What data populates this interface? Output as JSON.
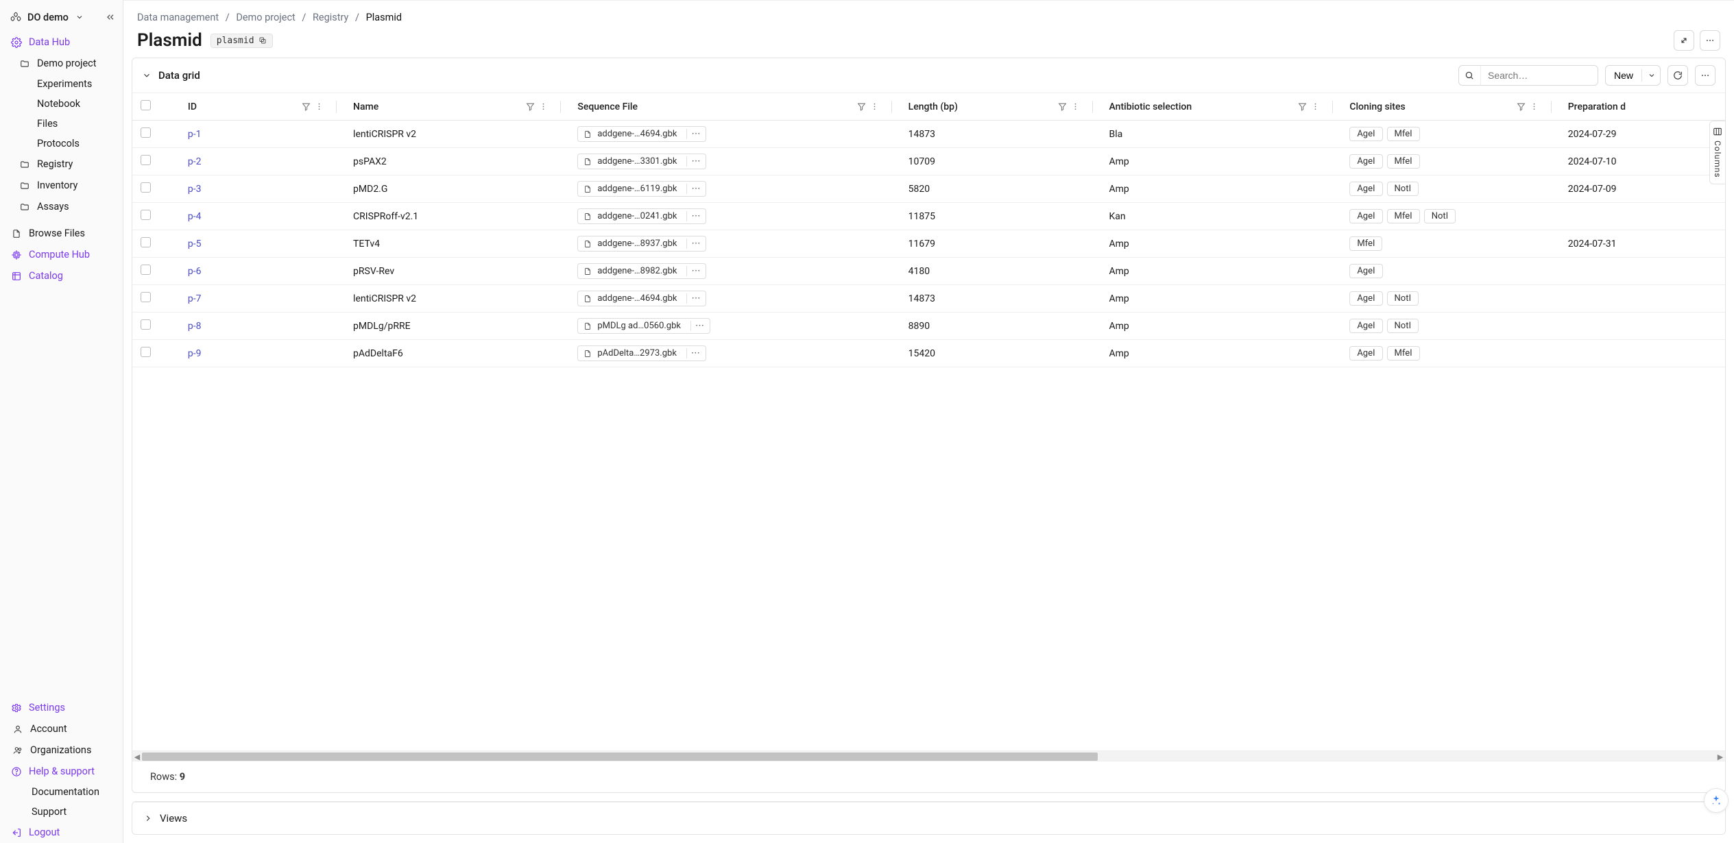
{
  "workspace": {
    "name": "DO demo"
  },
  "sidebar": {
    "data_hub_label": "Data Hub",
    "demo_project_label": "Demo project",
    "children": {
      "experiments": "Experiments",
      "notebook": "Notebook",
      "files": "Files",
      "protocols": "Protocols"
    },
    "registry_label": "Registry",
    "inventory_label": "Inventory",
    "assays_label": "Assays",
    "browse_files_label": "Browse Files",
    "compute_hub_label": "Compute Hub",
    "catalog_label": "Catalog",
    "settings_label": "Settings",
    "account_label": "Account",
    "organizations_label": "Organizations",
    "help_label": "Help & support",
    "documentation_label": "Documentation",
    "support_label": "Support",
    "logout_label": "Logout"
  },
  "breadcrumbs": {
    "a": "Data management",
    "b": "Demo project",
    "c": "Registry",
    "d": "Plasmid"
  },
  "page": {
    "title": "Plasmid",
    "code": "plasmid"
  },
  "grid": {
    "title": "Data grid",
    "search_placeholder": "Search…",
    "new_label": "New",
    "columns_tab_label": "Columns",
    "views_label": "Views",
    "rows_prefix": "Rows: ",
    "rows_count": "9",
    "headers": {
      "id": "ID",
      "name": "Name",
      "seq": "Sequence File",
      "len": "Length (bp)",
      "ant": "Antibiotic selection",
      "sites": "Cloning sites",
      "prep": "Preparation d"
    },
    "rows": [
      {
        "id": "p-1",
        "name": "lentiCRISPR v2",
        "file": "addgene-…4694.gbk",
        "len": "14873",
        "ant": "Bla",
        "sites": [
          "AgeI",
          "MfeI"
        ],
        "prep": "2024-07-29"
      },
      {
        "id": "p-2",
        "name": "psPAX2",
        "file": "addgene-…3301.gbk",
        "len": "10709",
        "ant": "Amp",
        "sites": [
          "AgeI",
          "MfeI"
        ],
        "prep": "2024-07-10"
      },
      {
        "id": "p-3",
        "name": "pMD2.G",
        "file": "addgene-…6119.gbk",
        "len": "5820",
        "ant": "Amp",
        "sites": [
          "AgeI",
          "NotI"
        ],
        "prep": "2024-07-09"
      },
      {
        "id": "p-4",
        "name": "CRISPRoff-v2.1",
        "file": "addgene-…0241.gbk",
        "len": "11875",
        "ant": "Kan",
        "sites": [
          "AgeI",
          "MfeI",
          "NotI"
        ],
        "prep": ""
      },
      {
        "id": "p-5",
        "name": "TETv4",
        "file": "addgene-…8937.gbk",
        "len": "11679",
        "ant": "Amp",
        "sites": [
          "MfeI"
        ],
        "prep": "2024-07-31"
      },
      {
        "id": "p-6",
        "name": "pRSV-Rev",
        "file": "addgene-…8982.gbk",
        "len": "4180",
        "ant": "Amp",
        "sites": [
          "AgeI"
        ],
        "prep": ""
      },
      {
        "id": "p-7",
        "name": "lentiCRISPR v2",
        "file": "addgene-…4694.gbk",
        "len": "14873",
        "ant": "Amp",
        "sites": [
          "AgeI",
          "NotI"
        ],
        "prep": ""
      },
      {
        "id": "p-8",
        "name": "pMDLg/pRRE",
        "file": "pMDLg ad…0560.gbk",
        "len": "8890",
        "ant": "Amp",
        "sites": [
          "AgeI",
          "NotI"
        ],
        "prep": ""
      },
      {
        "id": "p-9",
        "name": "pAdDeltaF6",
        "file": "pAdDelta…2973.gbk",
        "len": "15420",
        "ant": "Amp",
        "sites": [
          "AgeI",
          "MfeI"
        ],
        "prep": ""
      }
    ]
  }
}
